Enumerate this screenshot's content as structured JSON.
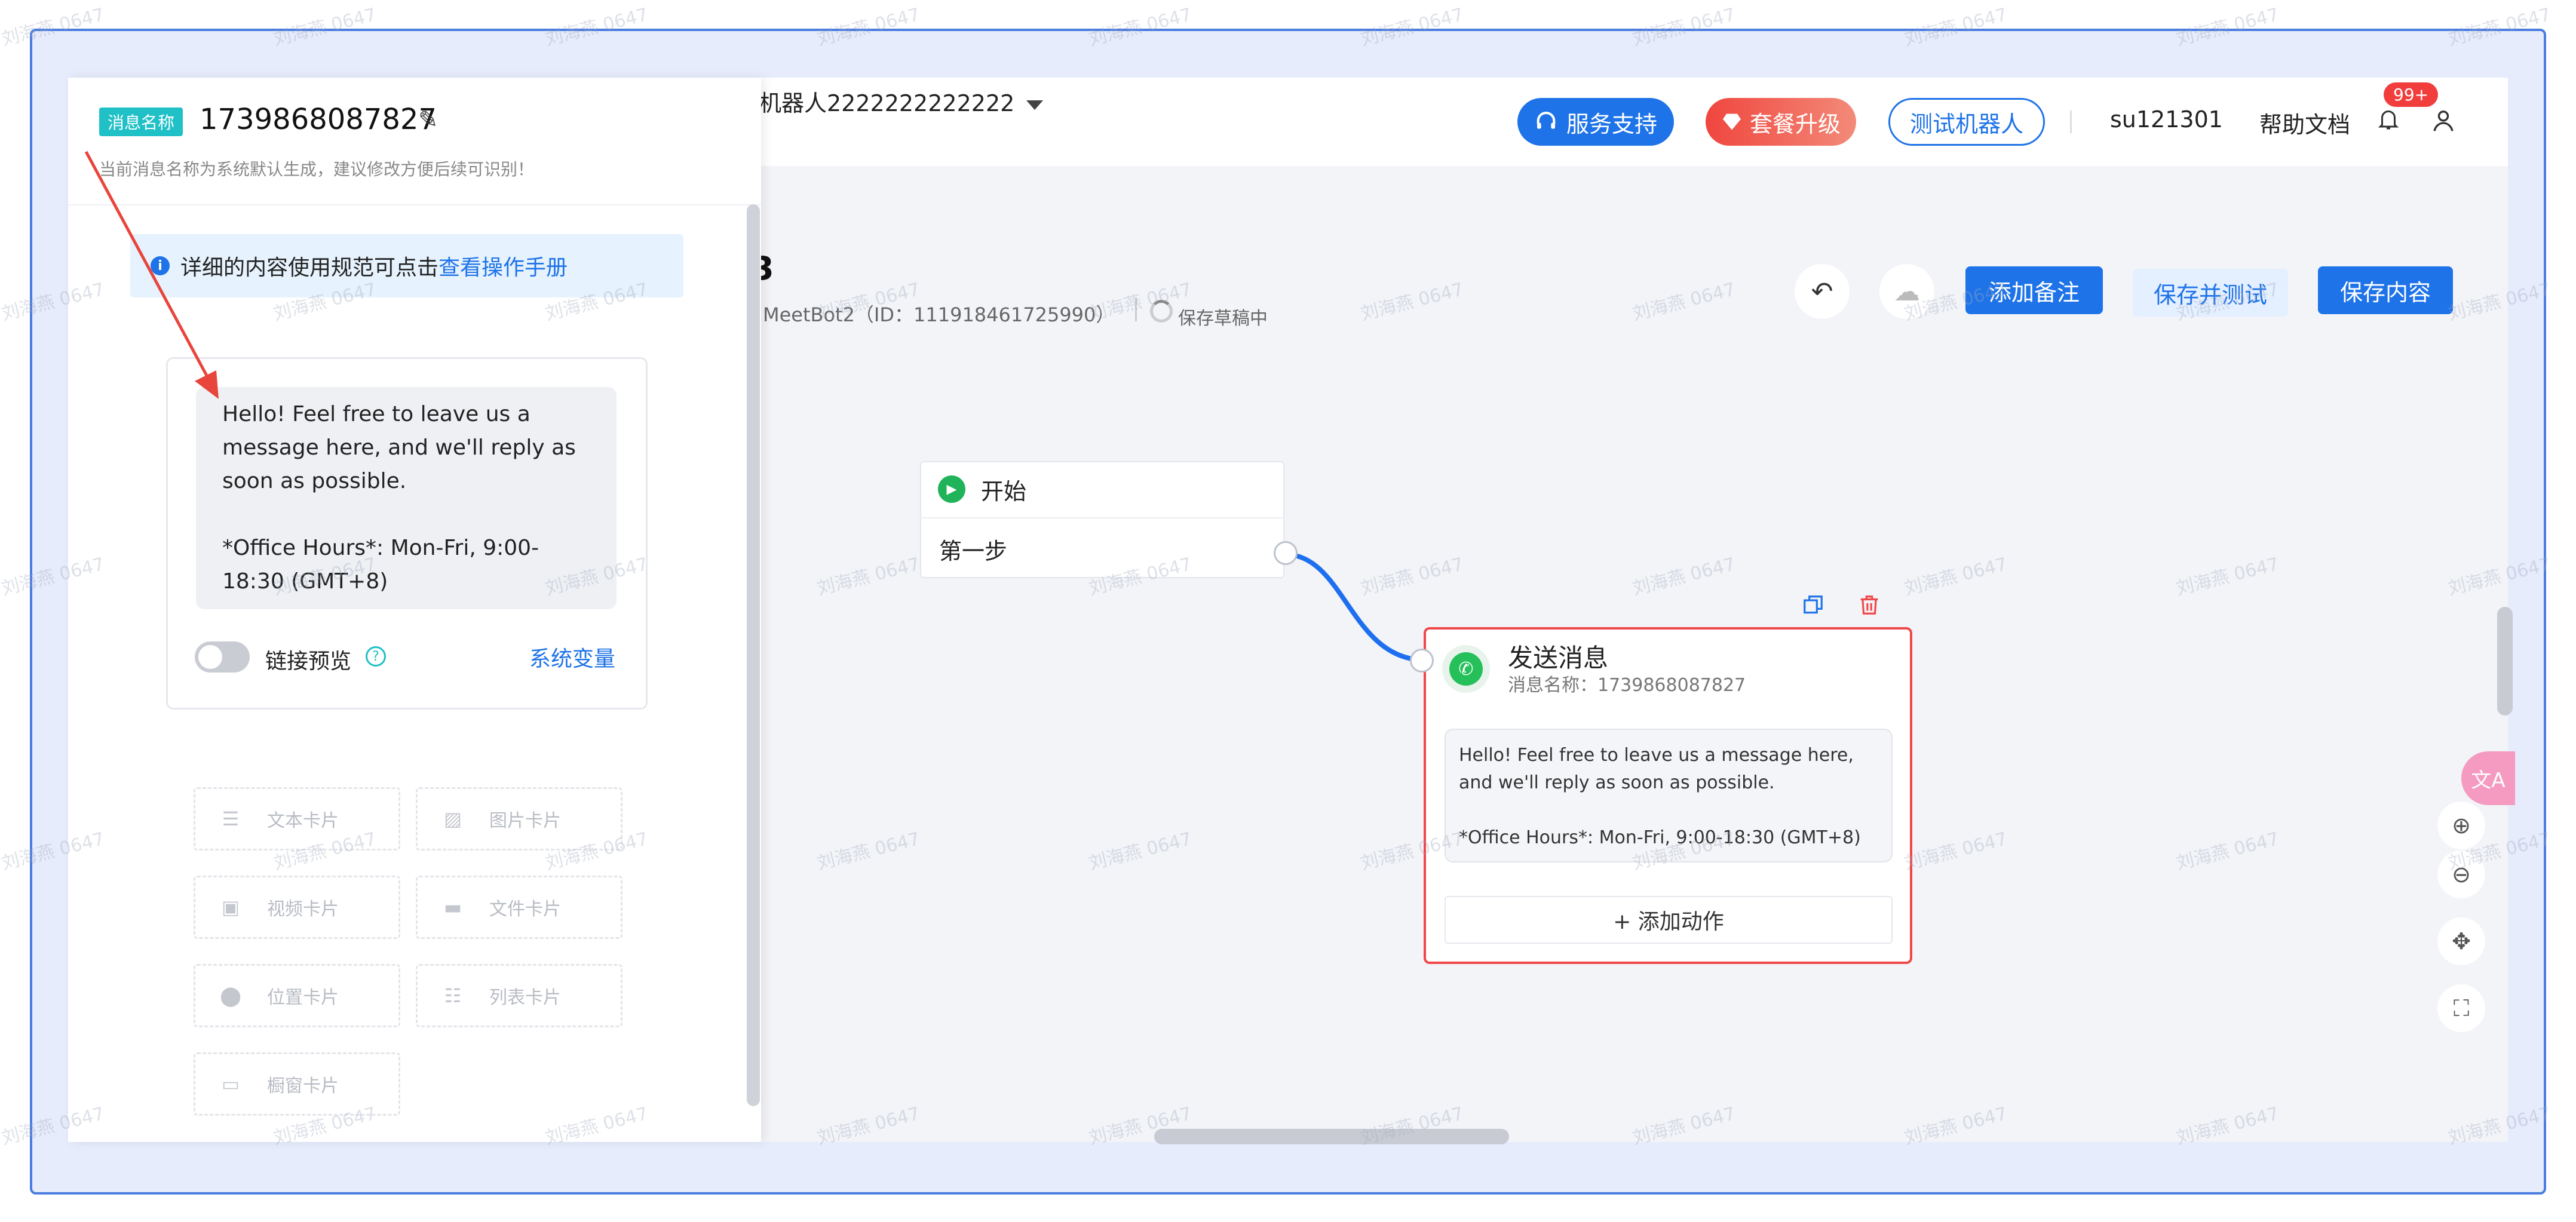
{
  "header": {
    "bot_name": "机器人2222222222222",
    "service_support": "服务支持",
    "upgrade": "套餐升级",
    "test_bot": "测试机器人",
    "username": "su121301",
    "help_docs": "帮助文档",
    "notification_count": "99+"
  },
  "toolbar": {
    "title_fragment": "3",
    "meta": ": MeetBot2（ID：111918461725990）",
    "saving_status": "保存草稿中",
    "add_note": "添加备注",
    "save_and_test": "保存并测试",
    "save_content": "保存内容"
  },
  "flow": {
    "start_node": {
      "title": "开始",
      "step": "第一步"
    },
    "send_node": {
      "title": "发送消息",
      "subtitle": "消息名称：1739868087827",
      "message": "Hello! Feel free to leave us a message here, and we'll reply as soon as possible.\n\n*Office Hours*: Mon-Fri, 9:00-18:30 (GMT+8)",
      "add_action": "+ 添加动作"
    }
  },
  "panel": {
    "tag": "消息名称",
    "message_name": "1739868087827",
    "hint": "当前消息名称为系统默认生成，建议修改方便后续可识别！",
    "info_text": "详细的内容使用规范可点击",
    "info_link": "查看操作手册",
    "message_text": "Hello! Feel free to leave us a message here, and we'll reply as soon as possible.\n\n*Office Hours*: Mon-Fri, 9:00-18:30 (GMT+8)",
    "link_preview": "链接预览",
    "link_preview_enabled": false,
    "system_variables": "系统变量",
    "card_types": {
      "text": "文本卡片",
      "image": "图片卡片",
      "video": "视频卡片",
      "file": "文件卡片",
      "location": "位置卡片",
      "list": "列表卡片",
      "window": "橱窗卡片"
    }
  },
  "watermark": "刘海燕 0647",
  "colors": {
    "primary": "#1e73e8",
    "danger": "#f0484a",
    "teal_tag": "#1fc0c6",
    "whatsapp": "#25c05a",
    "annotation_arrow": "#e8453c"
  }
}
